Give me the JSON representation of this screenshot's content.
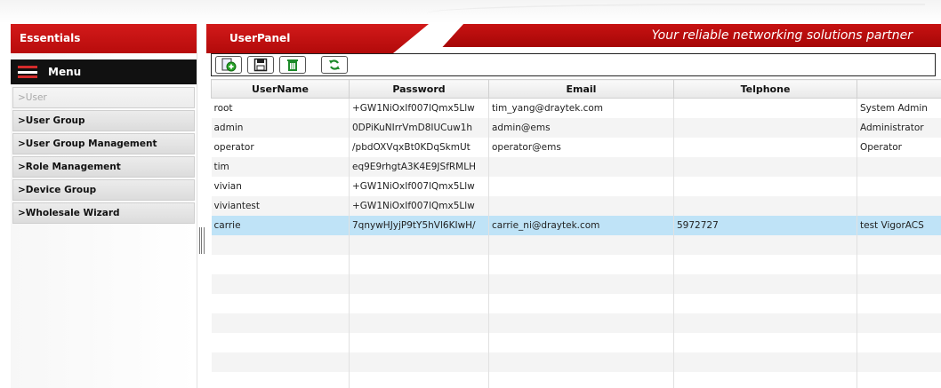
{
  "sidebar": {
    "header": "Essentials",
    "menu_label": "Menu",
    "items": [
      {
        "label": ">User"
      },
      {
        "label": ">User Group"
      },
      {
        "label": ">User Group Management"
      },
      {
        "label": ">Role Management"
      },
      {
        "label": ">Device Group"
      },
      {
        "label": ">Wholesale Wizard"
      }
    ]
  },
  "main": {
    "panel_title": "UserPanel",
    "slogan": "Your reliable networking solutions partner",
    "toolbar": [
      {
        "icon": "add-icon"
      },
      {
        "icon": "save-icon"
      },
      {
        "icon": "delete-icon"
      },
      {
        "icon": "refresh-icon"
      }
    ],
    "table": {
      "columns": [
        "UserName",
        "Password",
        "Email",
        "Telphone",
        ""
      ],
      "rows": [
        [
          "root",
          "+GW1NiOxIf007lQmx5Llw",
          "tim_yang@draytek.com",
          "",
          "System Admin"
        ],
        [
          "admin",
          "0DPiKuNIrrVmD8IUCuw1h",
          "admin@ems",
          "",
          "Administrator"
        ],
        [
          "operator",
          "/pbdOXVqxBt0KDqSkmUt",
          "operator@ems",
          "",
          "Operator"
        ],
        [
          "tim",
          "eq9E9rhgtA3K4E9JSfRMLH",
          "",
          "",
          ""
        ],
        [
          "vivian",
          "+GW1NiOxIf007lQmx5Llw",
          "",
          "",
          ""
        ],
        [
          "viviantest",
          "+GW1NiOxIf007lQmx5Llw",
          "",
          "",
          ""
        ],
        [
          "carrie",
          "7qnywHJyjP9tY5hVl6KIwH/",
          "carrie_ni@draytek.com",
          "5972727",
          "test VigorACS"
        ]
      ],
      "selected_row": 6
    }
  },
  "colors": {
    "brand_red": "#c71212",
    "selection": "#bfe3f7"
  }
}
